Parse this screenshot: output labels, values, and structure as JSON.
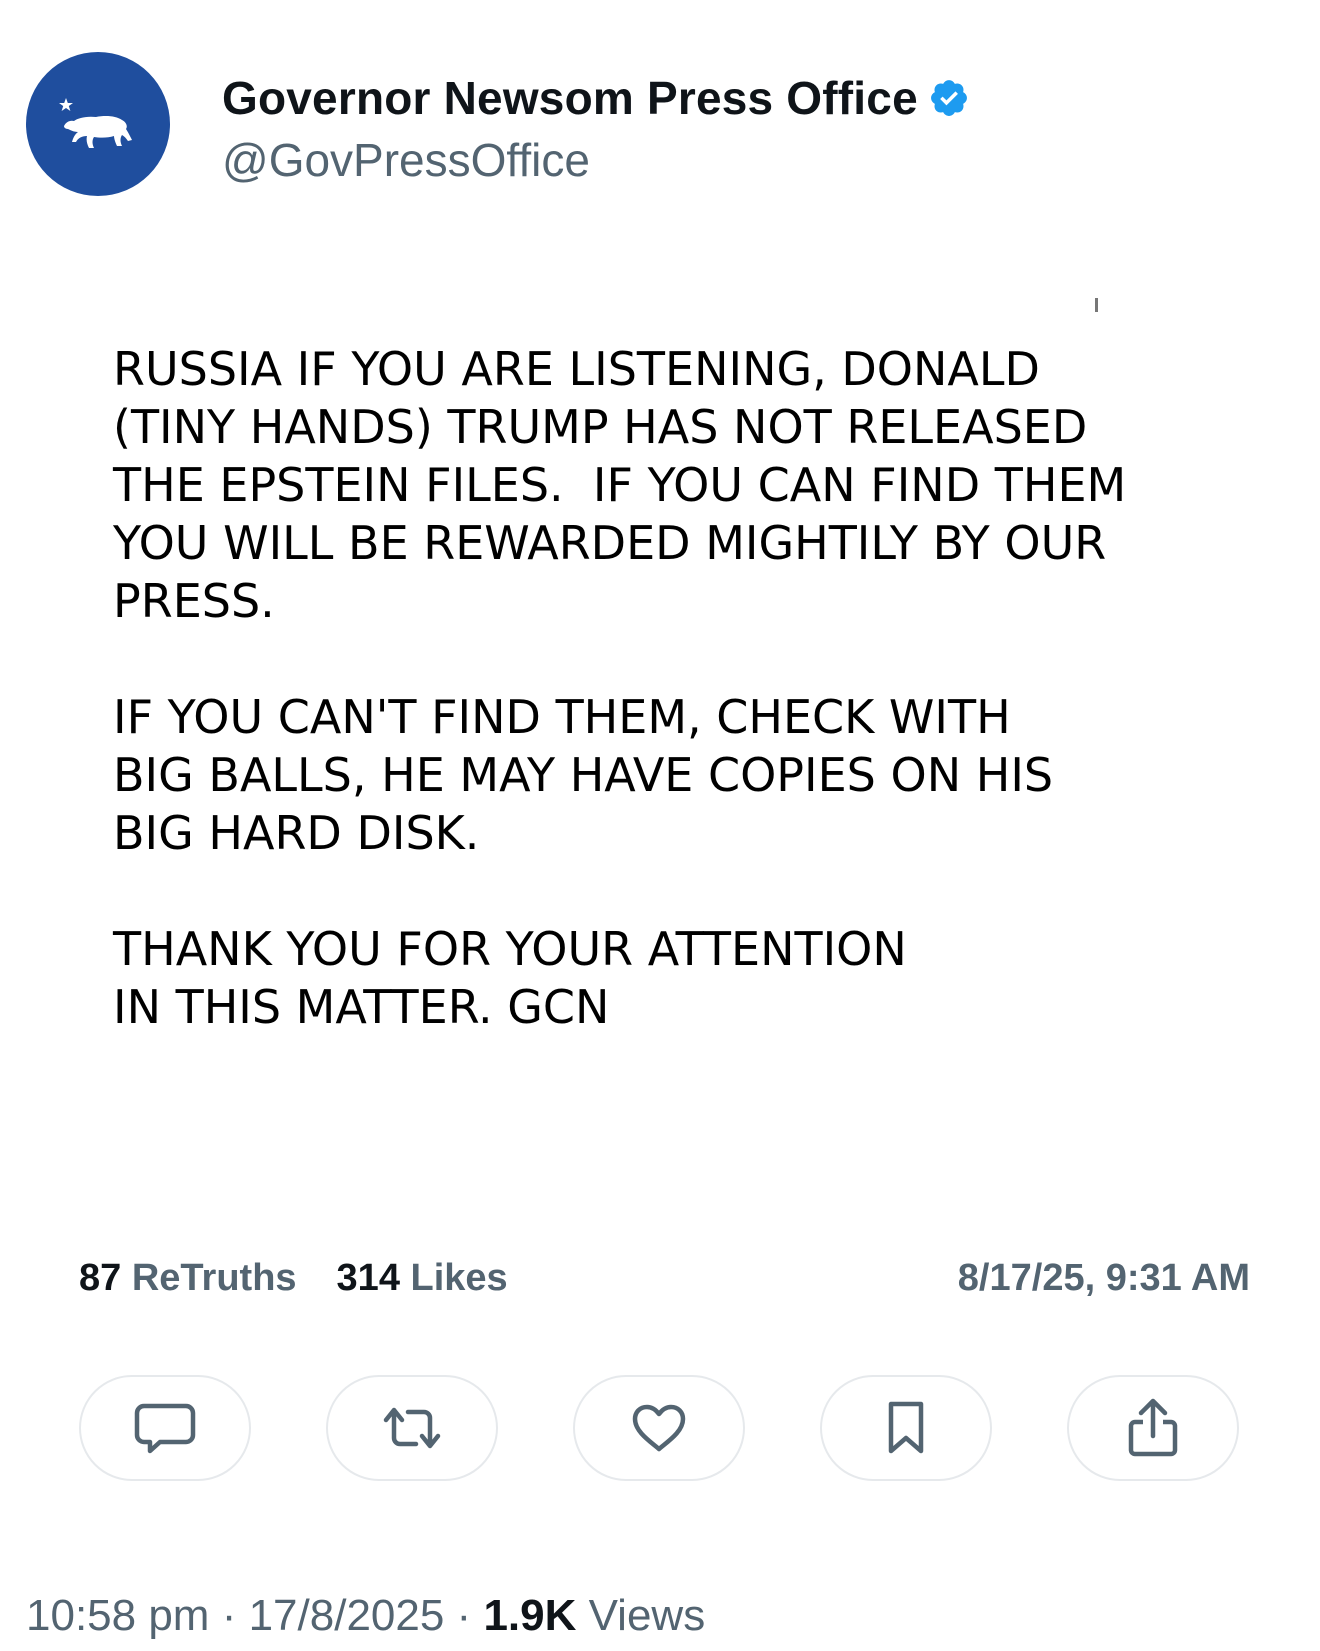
{
  "account": {
    "display_name": "Governor Newsom Press Office",
    "handle": "@GovPressOffice",
    "verified": true,
    "avatar_icon": "california-bear-star-icon",
    "avatar_color": "#1f4e9e",
    "verified_color": "#1d9bf0"
  },
  "post": {
    "text": "RUSSIA IF YOU ARE LISTENING, DONALD\n(TINY HANDS) TRUMP HAS NOT RELEASED\nTHE EPSTEIN FILES.  IF YOU CAN FIND THEM\nYOU WILL BE REWARDED MIGHTILY BY OUR\nPRESS.\n\nIF YOU CAN'T FIND THEM, CHECK WITH\nBIG BALLS, HE MAY HAVE COPIES ON HIS\nBIG HARD DISK.\n\nTHANK YOU FOR YOUR ATTENTION\nIN THIS MATTER. GCN",
    "retruths_count": "87",
    "retruths_label": "ReTruths",
    "likes_count": "314",
    "likes_label": "Likes",
    "posted_at": "8/17/25, 9:31 AM"
  },
  "actions": [
    {
      "name": "reply",
      "icon": "comment-icon"
    },
    {
      "name": "retruth",
      "icon": "repost-icon"
    },
    {
      "name": "like",
      "icon": "heart-icon"
    },
    {
      "name": "bookmark",
      "icon": "bookmark-icon"
    },
    {
      "name": "share",
      "icon": "share-icon"
    }
  ],
  "meta": {
    "time": "10:58 pm",
    "separator": " · ",
    "date": "17/8/2025",
    "views_count": "1.9K",
    "views_label": "Views"
  }
}
